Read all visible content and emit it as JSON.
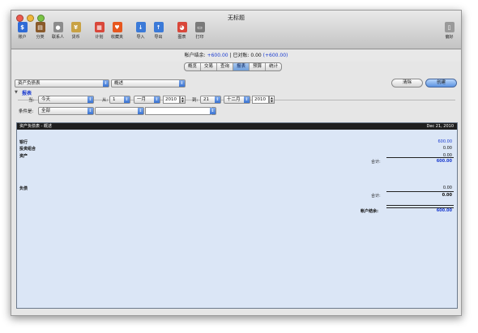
{
  "window": {
    "title": "无标题"
  },
  "toolbar": {
    "items": [
      {
        "label": "账户",
        "icon": "account-icon",
        "color": "#2f6bd6",
        "glyph": "$"
      },
      {
        "label": "分类",
        "icon": "category-icon",
        "color": "#8a5a2b",
        "glyph": "▤"
      },
      {
        "label": "联系人",
        "icon": "contact-icon",
        "color": "#8c8c8c",
        "glyph": "●"
      },
      {
        "label": "货币",
        "icon": "currency-icon",
        "color": "#c9a244",
        "glyph": "¥"
      },
      {
        "label": "计划",
        "icon": "calendar-icon",
        "color": "#d9473a",
        "glyph": "▦"
      },
      {
        "label": "收藏夹",
        "icon": "heart-icon",
        "color": "#e7571f",
        "glyph": "♥"
      },
      {
        "label": "导入",
        "icon": "import-icon",
        "color": "#3b7ad8",
        "glyph": "↓"
      },
      {
        "label": "导出",
        "icon": "export-icon",
        "color": "#3b7ad8",
        "glyph": "↑"
      },
      {
        "label": "图表",
        "icon": "pie-chart-icon",
        "color": "#d9473a",
        "glyph": "◕"
      },
      {
        "label": "打印",
        "icon": "printer-icon",
        "color": "#7a7a7a",
        "glyph": "▭"
      }
    ],
    "prefs": {
      "label": "偏好",
      "icon": "prefs-icon",
      "color": "#9a9a9a",
      "glyph": "▯"
    }
  },
  "status": {
    "balance_label": "帐户结余:",
    "balance_value": "+600.00",
    "cleared_label": "| 已对账:",
    "cleared_value": "0.00",
    "cleared_paren": "(+600.00)"
  },
  "tabs": [
    "概览",
    "交易",
    "查询",
    "报表",
    "预算",
    "统计"
  ],
  "active_tab": 3,
  "controls": {
    "report_select": "资产负债表",
    "mode_select": "概述",
    "clear_button": "清除",
    "create_button": "创建"
  },
  "section": {
    "label": "报表"
  },
  "filters": {
    "when_label": "当:",
    "when_value": "今天",
    "from_label": "从:",
    "from_day": "1",
    "from_month": "一月",
    "from_year": "2010",
    "to_label": "到:",
    "to_day": "21",
    "to_month": "十二月",
    "to_year": "2010",
    "condition_label": "条件是:",
    "condition_value": "全部",
    "condition_op": "",
    "condition_text": ""
  },
  "report": {
    "title": "资产负债表 - 概述",
    "date": "Dec 21, 2010",
    "rows": [
      {
        "label": "银行",
        "value": "600.00",
        "blue": true
      },
      {
        "label": "投资组合",
        "value": "0.00",
        "blue": false
      },
      {
        "label": "资产",
        "value": "0.00",
        "blue": false
      }
    ],
    "assets_total_label": "合计:",
    "assets_total_value": "600.00",
    "liab_label": "负债",
    "liab_value": "0.00",
    "liab_total_label": "合计:",
    "liab_total_value": "0.00",
    "net_label": "帐户结余:",
    "net_value": "600.00"
  }
}
